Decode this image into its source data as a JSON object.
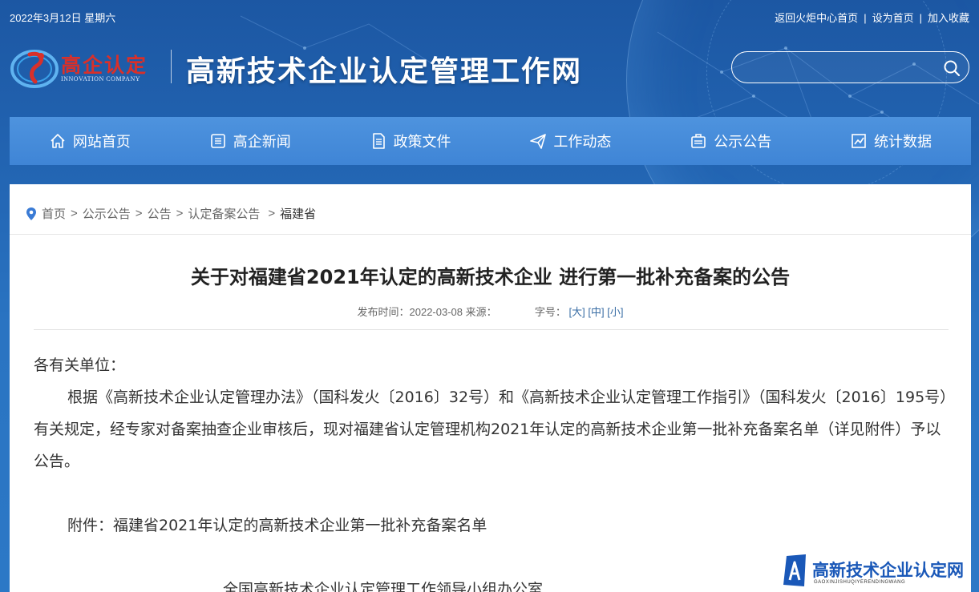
{
  "topbar": {
    "date": "2022年3月12日 星期六",
    "links": [
      "返回火炬中心首页",
      "设为首页",
      "加入收藏"
    ],
    "separator": "|"
  },
  "logo": {
    "text": "高企认定",
    "subtitle": "INNOVATION COMPANY"
  },
  "site": {
    "title": "高新技术企业认定管理工作网"
  },
  "search": {
    "placeholder": "",
    "icon": "search-icon"
  },
  "nav": {
    "items": [
      {
        "label": "网站首页",
        "icon": "home-icon"
      },
      {
        "label": "高企新闻",
        "icon": "news-icon"
      },
      {
        "label": "政策文件",
        "icon": "document-icon"
      },
      {
        "label": "工作动态",
        "icon": "paper-plane-icon"
      },
      {
        "label": "公示公告",
        "icon": "notice-icon"
      },
      {
        "label": "统计数据",
        "icon": "chart-icon"
      }
    ]
  },
  "breadcrumb": {
    "items": [
      "首页",
      "公示公告",
      "公告",
      "认定备案公告"
    ],
    "current": "福建省",
    "arrow": ">"
  },
  "article": {
    "title": "关于对福建省2021年认定的高新技术企业 进行第一批补充备案的公告",
    "meta": {
      "publish_label": "发布时间：",
      "publish_date": "2022-03-08",
      "source_label": "来源：",
      "source": "",
      "font_label": "字号：",
      "font_sizes": [
        "[大]",
        "[中]",
        "[小]"
      ]
    },
    "salutation": "各有关单位：",
    "paragraph": "根据《高新技术企业认定管理办法》（国科发火〔2016〕32号）和《高新技术企业认定管理工作指引》（国科发火〔2016〕195号）有关规定，经专家对备案抽查企业审核后，现对福建省认定管理机构2021年认定的高新技术企业第一批补充备案名单（详见附件）予以公告。",
    "attachment": "附件：福建省2021年认定的高新技术企业第一批补充备案名单",
    "signature": "全国高新技术企业认定管理工作领导小组办公室"
  },
  "watermark": {
    "text": "高新技术企业认定网",
    "sub": "GAOXINJISHUQIYERENDINGWANG"
  },
  "colors": {
    "header_blue": "#1c57a3",
    "nav_blue": "#4e93de",
    "logo_red": "#d8302a",
    "link_blue": "#3a6ea5"
  }
}
